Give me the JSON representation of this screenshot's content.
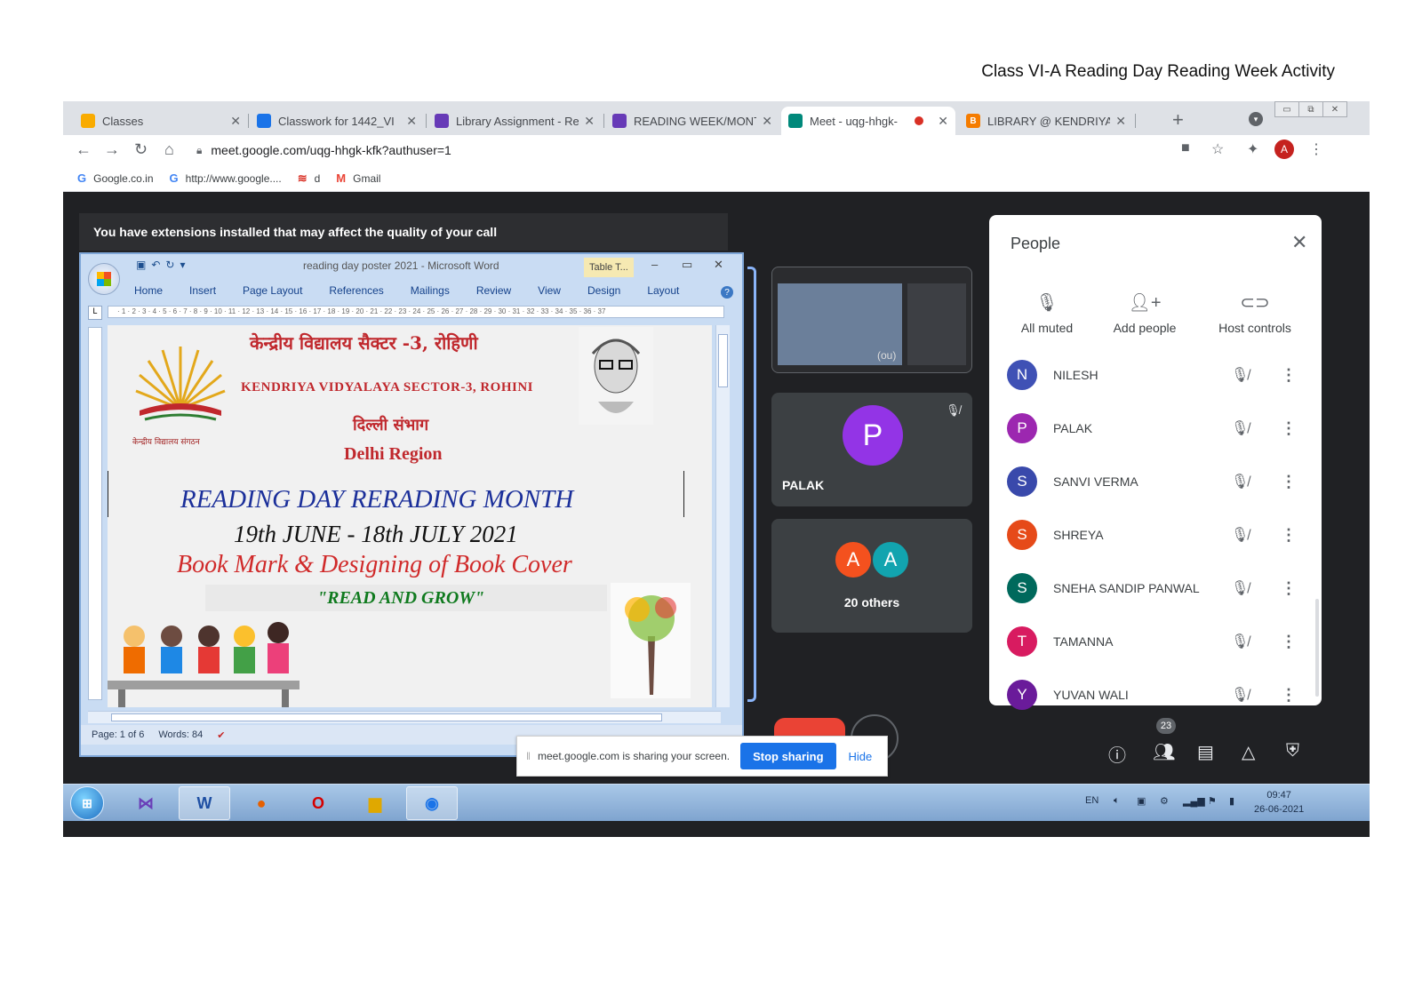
{
  "page_caption": "Class VI-A  Reading Day Reading Week Activity",
  "browser": {
    "tabs": [
      {
        "title": "Classes",
        "icon": "classroom-icon",
        "color": "#f9ab00"
      },
      {
        "title": "Classwork for 1442_VI",
        "icon": "classroom-icon",
        "color": "#1a73e8"
      },
      {
        "title": "Library Assignment - Re",
        "icon": "forms-icon",
        "color": "#673ab7"
      },
      {
        "title": "READING WEEK/MONT",
        "icon": "forms-icon",
        "color": "#673ab7"
      },
      {
        "title": "Meet - uqg-hhgk-",
        "icon": "meet-icon",
        "color": "#00897b"
      },
      {
        "title": "LIBRARY @ KENDRIYA",
        "icon": "blogger-icon",
        "color": "#f57c00"
      }
    ],
    "url": "meet.google.com/uqg-hhgk-kfk?authuser=1",
    "profile_initial": "A",
    "bookmarks": [
      {
        "label": "Google.co.in",
        "icon": "G"
      },
      {
        "label": "http://www.google....",
        "icon": "G"
      },
      {
        "label": "d",
        "icon": "≋"
      },
      {
        "label": "Gmail",
        "icon": "M"
      }
    ]
  },
  "meet": {
    "banner": "You have extensions installed that may affect the quality of your call",
    "tiles": {
      "you_label": "(ou)",
      "palak": {
        "initial": "P",
        "name": "PALAK",
        "color": "#9334e6"
      },
      "others": {
        "avatars": [
          {
            "initial": "A",
            "color": "#f4511e"
          },
          {
            "initial": "A",
            "color": "#12a4af"
          }
        ],
        "label": "20 others"
      }
    },
    "people_panel": {
      "title": "People",
      "actions": {
        "all_muted": "All muted",
        "add_people": "Add people",
        "host_controls": "Host controls"
      },
      "participants": [
        {
          "initial": "N",
          "name": "NILESH",
          "color": "#3f51b5"
        },
        {
          "initial": "P",
          "name": "PALAK",
          "color": "#9c27b0"
        },
        {
          "initial": "S",
          "name": "SANVI VERMA",
          "color": "#3949ab"
        },
        {
          "initial": "S",
          "name": "SHREYA",
          "color": "#e64a19"
        },
        {
          "initial": "S",
          "name": "SNEHA SANDIP PANWAL",
          "color": "#00695c"
        },
        {
          "initial": "T",
          "name": "TAMANNA",
          "color": "#d81b60"
        },
        {
          "initial": "Y",
          "name": "YUVAN WALI",
          "color": "#6a1b9a"
        }
      ]
    },
    "participant_count": "23",
    "sharing_bar": {
      "message": "meet.google.com is sharing your screen.",
      "stop": "Stop sharing",
      "hide": "Hide"
    }
  },
  "word": {
    "caption": "reading day poster 2021 - Microsoft Word",
    "table_tools": "Table T...",
    "ribbon_tabs": [
      "Home",
      "Insert",
      "Page Layout",
      "References",
      "Mailings",
      "Review",
      "View",
      "Design",
      "Layout"
    ],
    "status": {
      "page": "Page: 1 of 6",
      "words": "Words: 84"
    },
    "document": {
      "hindi_title": "केन्द्रीय विद्यालय सैक्टर -3, रोहिणी",
      "school": "KENDRIYA VIDYALAYA SECTOR-3, ROHINI",
      "region_hindi": "दिल्ली संभाग",
      "region": "Delhi Region",
      "headline": "READING DAY RERADING MONTH",
      "dates": "19th JUNE - 18th JULY 2021",
      "activity": "Book Mark & Designing of Book Cover",
      "slogan": "\"READ AND GROW\"",
      "logo_caption": "केन्द्रीय विद्यालय संगठन"
    }
  },
  "taskbar": {
    "language": "EN",
    "time": "09:47",
    "date": "26-06-2021"
  }
}
